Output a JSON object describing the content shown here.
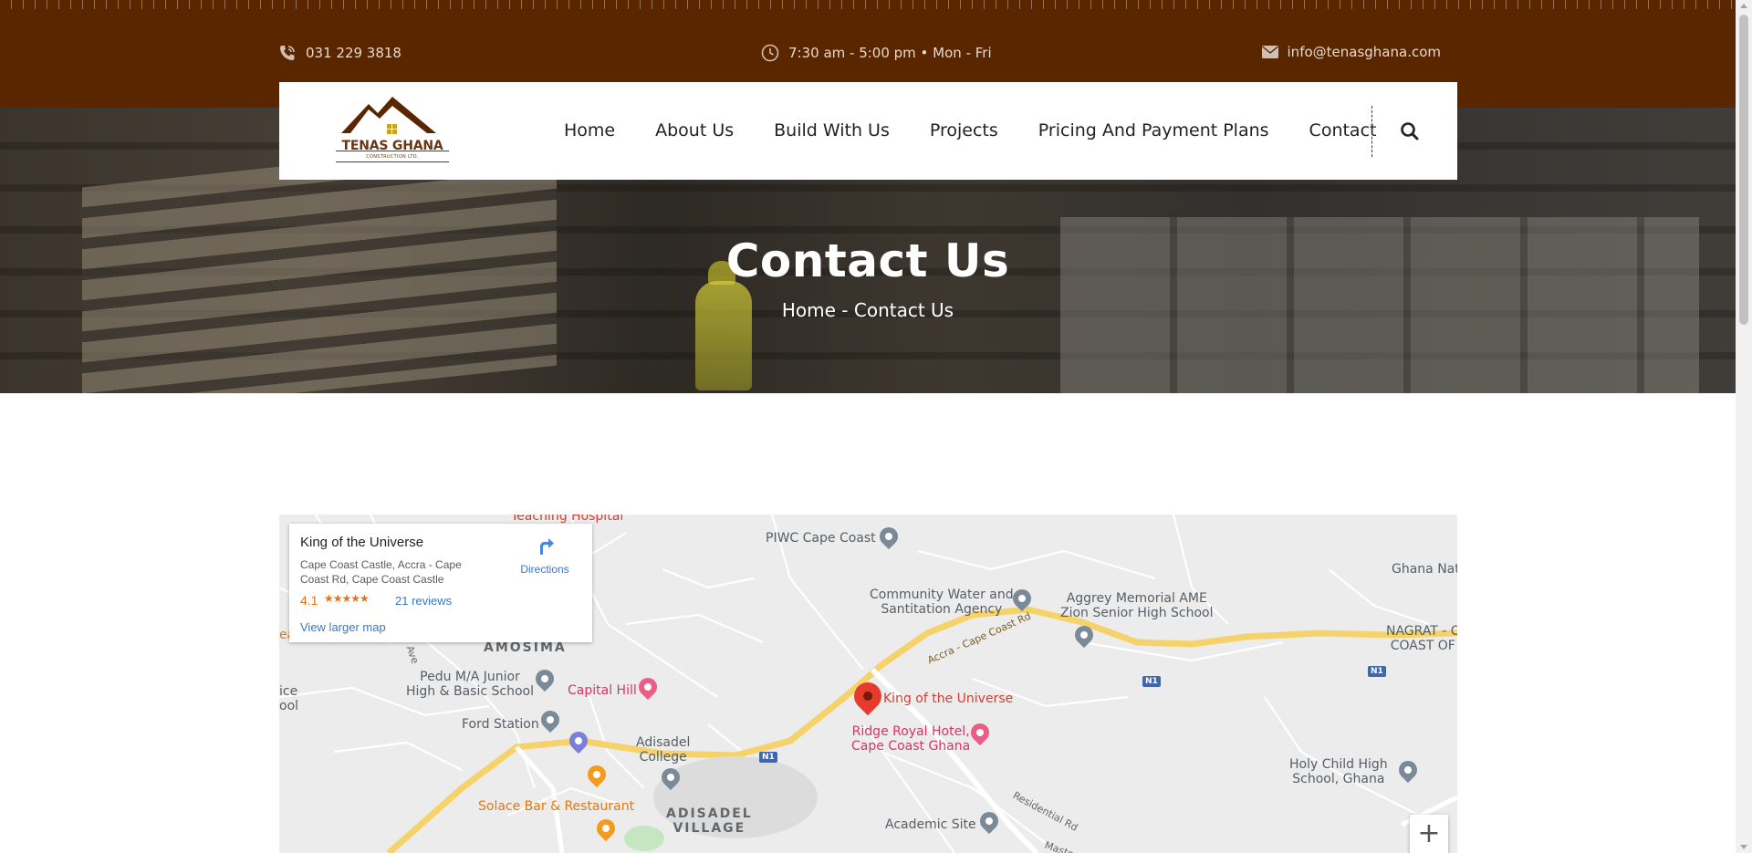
{
  "topbar": {
    "phone": "031 229 3818",
    "hours": "7:30 am - 5:00 pm • Mon - Fri",
    "email": "info@tenasghana.com"
  },
  "logo": {
    "name": "TENAS GHANA",
    "sub": "CONSTRUCTION LTD."
  },
  "nav": {
    "items": [
      {
        "label": "Home"
      },
      {
        "label": "About Us"
      },
      {
        "label": "Build With Us"
      },
      {
        "label": "Projects"
      },
      {
        "label": "Pricing And Payment Plans"
      },
      {
        "label": "Contact"
      }
    ]
  },
  "hero": {
    "title": "Contact Us",
    "breadcrumb": "Home - Contact Us"
  },
  "map": {
    "infowindow": {
      "title": "King of the Universe",
      "address": "Cape Coast Castle, Accra - Cape Coast Rd, Cape Coast Castle",
      "rating": "4.1",
      "stars": "★★★★★",
      "reviews": "21 reviews",
      "directions": "Directions",
      "view_larger": "View larger map"
    },
    "labels": {
      "teaching_hospital": "Teaching Hospital",
      "piwc": "PIWC Cape Coast",
      "community_water": "Community Water and\nSantitation Agency",
      "aggrey": "Aggrey Memorial AME\nZion Senior High School",
      "ghana_nat": "Ghana Nat",
      "nagrat": "NAGRAT - C\nCOAST OF",
      "amosima": "AMOSIMA",
      "pedu": "Pedu M/A Junior\nHigh & Basic School",
      "capital_hill": "Capital Hill",
      "king": "King of the Universe",
      "ridge": "Ridge Royal Hotel,\nCape Coast Ghana",
      "ford": "Ford Station",
      "adisadel_college": "Adisadel\nCollege",
      "solace": "Solace Bar & Restaurant",
      "adisadel_village": "ADISADEL\nVILLAGE",
      "academic": "Academic Site",
      "holy_child": "Holy Child High\nSchool, Ghana",
      "accra_rd": "Accra - Cape Coast Rd",
      "residential_rd": "Residential Rd",
      "n1": "N1",
      "ave": "r Ave",
      "ea": "ea",
      "ice": "ice\nool",
      "maste": "Maste"
    },
    "zoom_in": "+"
  }
}
